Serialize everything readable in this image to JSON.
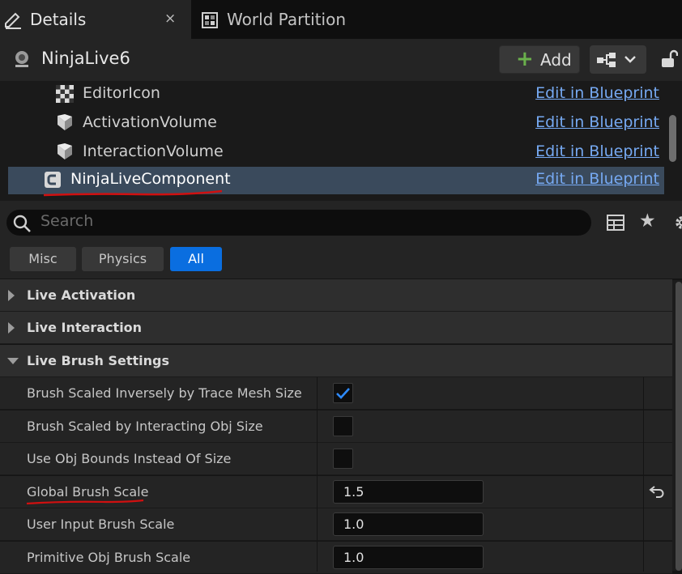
{
  "tabs": [
    {
      "label": "Details",
      "close": "×"
    },
    {
      "label": "World Partition"
    }
  ],
  "header": {
    "actor_name": "NinjaLive6",
    "add_label": "Add"
  },
  "components": [
    {
      "name": "EditorIcon",
      "action": "Edit in Blueprint"
    },
    {
      "name": "ActivationVolume",
      "action": "Edit in Blueprint"
    },
    {
      "name": "InteractionVolume",
      "action": "Edit in Blueprint"
    },
    {
      "name": "NinjaLiveComponent",
      "action": "Edit in Blueprint",
      "selected": true
    }
  ],
  "search": {
    "placeholder": "Search"
  },
  "filters": [
    {
      "label": "Misc",
      "active": false
    },
    {
      "label": "Physics",
      "active": false
    },
    {
      "label": "All",
      "active": true
    }
  ],
  "categories": [
    {
      "label": "Live Activation",
      "expanded": false
    },
    {
      "label": "Live Interaction",
      "expanded": false
    },
    {
      "label": "Live Brush Settings",
      "expanded": true
    }
  ],
  "properties": [
    {
      "label": "Brush Scaled Inversely by Trace Mesh Size",
      "type": "checkbox",
      "checked": true
    },
    {
      "label": "Brush Scaled by Interacting Obj Size",
      "type": "checkbox",
      "checked": false
    },
    {
      "label": "Use Obj Bounds Instead Of Size",
      "type": "checkbox",
      "checked": false
    },
    {
      "label": "Global Brush Scale",
      "type": "number",
      "value": "1.5",
      "modified": true
    },
    {
      "label": "User Input Brush Scale",
      "type": "number",
      "value": "1.0"
    },
    {
      "label": "Primitive Obj Brush Scale",
      "type": "number",
      "value": "1.0"
    }
  ],
  "colors": {
    "accent": "#0a6ee0",
    "link": "#76a9f2",
    "selection": "#3a4a5c",
    "annotation": "#d01010",
    "add_plus": "#6ab04c"
  },
  "icons": {
    "details_tab": "pencil-icon",
    "world_partition_tab": "grid-map-icon",
    "actor": "actor-icon",
    "lock": "unlock-icon"
  }
}
